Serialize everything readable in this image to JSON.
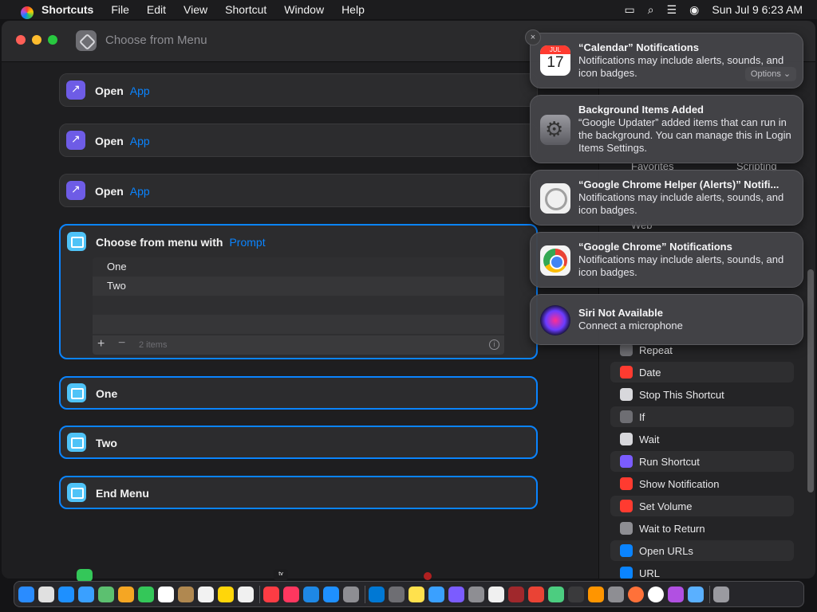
{
  "menubar": {
    "app_name": "Shortcuts",
    "items": [
      "File",
      "Edit",
      "View",
      "Shortcut",
      "Window",
      "Help"
    ],
    "datetime": "Sun Jul 9  6:23 AM"
  },
  "window": {
    "title": "Choose from Menu"
  },
  "editor": {
    "open_actions": [
      {
        "label": "Open",
        "token": "App"
      },
      {
        "label": "Open",
        "token": "App"
      },
      {
        "label": "Open",
        "token": "App"
      }
    ],
    "choose_card": {
      "label": "Choose from menu with",
      "token": "Prompt",
      "items": [
        "One",
        "Two"
      ],
      "count_label": "2 items"
    },
    "case_one": "One",
    "case_two": "Two",
    "end_menu": "End Menu"
  },
  "sidebar": {
    "behind_labels": [
      "Favorites",
      "Scripting",
      "Web"
    ],
    "actions": [
      {
        "label": "Repeat",
        "icon": "repeat-icon",
        "color": "#6e6e73"
      },
      {
        "label": "Date",
        "icon": "calendar-icon",
        "color": "#ff3b30"
      },
      {
        "label": "Stop This Shortcut",
        "icon": "stop-icon",
        "color": "#d8d8dc"
      },
      {
        "label": "If",
        "icon": "branch-icon",
        "color": "#6e6e73"
      },
      {
        "label": "Wait",
        "icon": "clock-icon",
        "color": "#d8d8dc"
      },
      {
        "label": "Run Shortcut",
        "icon": "shortcuts-icon",
        "color": "#7b5cff"
      },
      {
        "label": "Show Notification",
        "icon": "bell-icon",
        "color": "#ff3b30"
      },
      {
        "label": "Set Volume",
        "icon": "speaker-icon",
        "color": "#ff3b30"
      },
      {
        "label": "Wait to Return",
        "icon": "apps-icon",
        "color": "#8e8e93"
      },
      {
        "label": "Open URLs",
        "icon": "safari-icon",
        "color": "#0a84ff"
      },
      {
        "label": "URL",
        "icon": "link-icon",
        "color": "#0a84ff"
      }
    ]
  },
  "notifications": [
    {
      "title": "“Calendar” Notifications",
      "body": "Notifications may include alerts, sounds, and icon badges.",
      "icon": "calendar-icon",
      "month": "JUL",
      "day": "17",
      "options_label": "Options ⌄"
    },
    {
      "title": "Background Items Added",
      "body": "“Google Updater” added items that can run in the background. You can manage this in Login Items Settings.",
      "icon": "settings-gear-icon"
    },
    {
      "title": "“Google Chrome Helper (Alerts)” Notifi...",
      "body": "Notifications may include alerts, sounds, and icon badges.",
      "icon": "chrome-helper-icon"
    },
    {
      "title": "“Google Chrome” Notifications",
      "body": "Notifications may include alerts, sounds, and icon badges.",
      "icon": "chrome-icon"
    },
    {
      "title": "Siri Not Available",
      "body": "Connect a microphone",
      "icon": "siri-icon"
    }
  ],
  "close_label": "×",
  "dock": {
    "items": [
      {
        "name": "finder-icon",
        "color": "#2a8cff"
      },
      {
        "name": "launchpad-icon",
        "color": "#e0e0e0"
      },
      {
        "name": "safari-icon",
        "color": "#1e90ff"
      },
      {
        "name": "mail-icon",
        "color": "#3aa0ff"
      },
      {
        "name": "maps-icon",
        "color": "#5cc070"
      },
      {
        "name": "photos-icon",
        "color": "#f5a623"
      },
      {
        "name": "facetime-icon",
        "color": "#34c759"
      },
      {
        "name": "calendar-icon",
        "color": "#ffffff"
      },
      {
        "name": "contacts-icon",
        "color": "#b08850"
      },
      {
        "name": "reminders-icon",
        "color": "#f2f2f2"
      },
      {
        "name": "notes-icon",
        "color": "#ffd60a"
      },
      {
        "name": "freeform-icon",
        "color": "#f0f0f0"
      },
      {
        "name": "music-icon",
        "color": "#fc3c44"
      },
      {
        "name": "news-icon",
        "color": "#ff375f"
      },
      {
        "name": "keynote-icon",
        "color": "#1e88e5"
      },
      {
        "name": "app-store-icon",
        "color": "#1e90ff"
      },
      {
        "name": "system-settings-icon",
        "color": "#8e8e93"
      },
      {
        "name": "vscode-icon",
        "color": "#0078d4"
      },
      {
        "name": "screenshot-icon",
        "color": "#6e6e73"
      },
      {
        "name": "stickies-icon",
        "color": "#ffe14d"
      },
      {
        "name": "migration-icon",
        "color": "#3aa0ff"
      },
      {
        "name": "shortcuts-icon",
        "color": "#7b5cff"
      },
      {
        "name": "script-editor-icon",
        "color": "#8e8e93"
      },
      {
        "name": "textedit-icon",
        "color": "#f0f0f0"
      },
      {
        "name": "dictionary-icon",
        "color": "#a0282c"
      },
      {
        "name": "chrome-icon",
        "color": "#ea4335"
      },
      {
        "name": "activity-monitor-icon",
        "color": "#4ccd80"
      },
      {
        "name": "voice-memos-icon",
        "color": "#3a3a3c"
      },
      {
        "name": "books-icon",
        "color": "#ff9500"
      },
      {
        "name": "calculator-icon",
        "color": "#8e8e93"
      },
      {
        "name": "firefox-icon",
        "color": "#ff7139"
      },
      {
        "name": "clock-icon",
        "color": "#ffffff"
      },
      {
        "name": "podcasts-icon",
        "color": "#b150e2"
      },
      {
        "name": "downloads-folder-icon",
        "color": "#5ab0ff"
      },
      {
        "name": "trash-icon",
        "color": "#9a9aa0"
      }
    ]
  }
}
